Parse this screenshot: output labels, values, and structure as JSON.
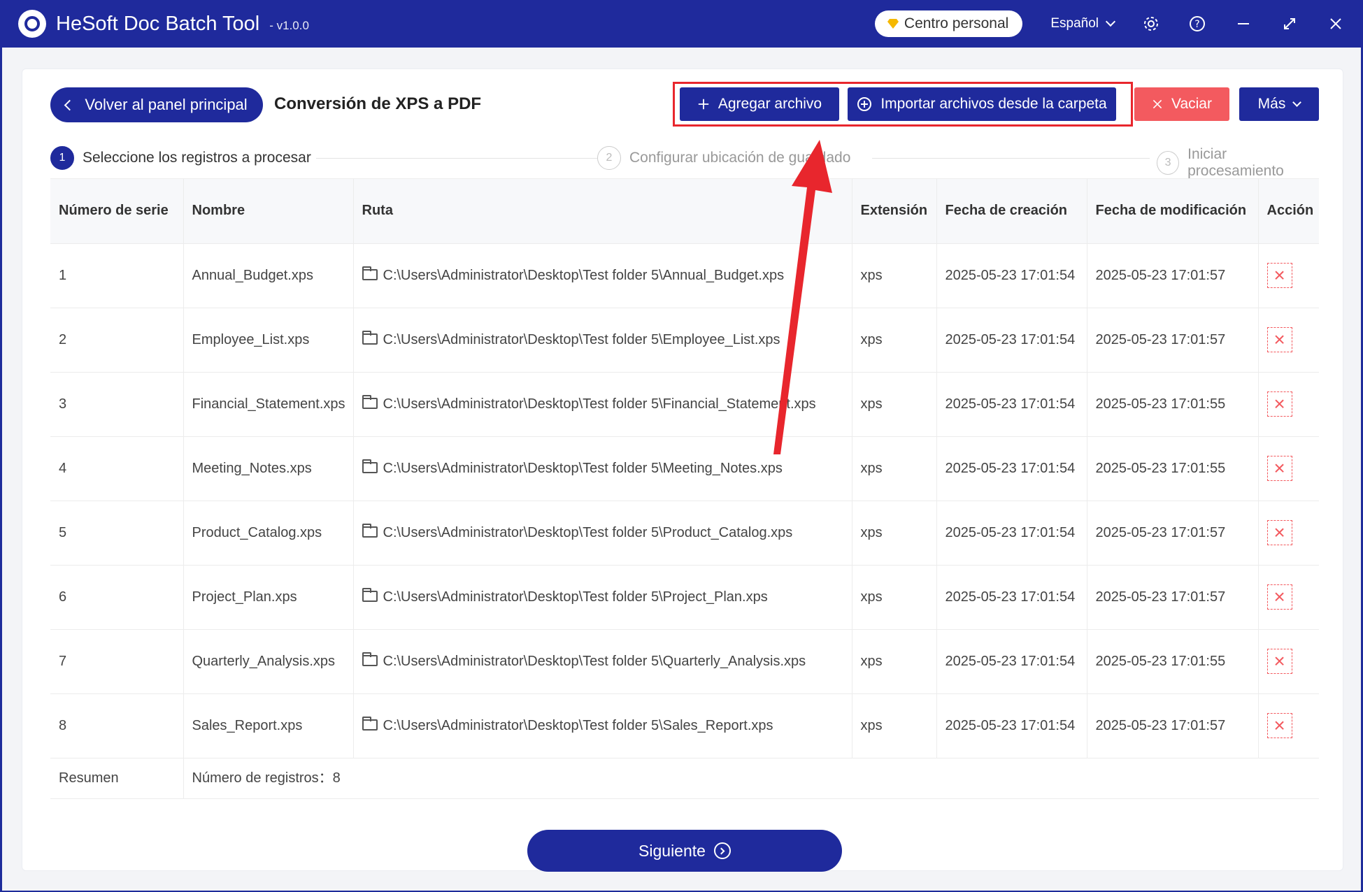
{
  "app": {
    "name": "HeSoft Doc Batch Tool",
    "version": "- v1.0.0",
    "personal_center": "Centro personal",
    "language": "Español"
  },
  "toolbar": {
    "back_label": "Volver al panel principal",
    "page_title": "Conversión de XPS a PDF",
    "add_file": "Agregar archivo",
    "import_folder": "Importar archivos desde la carpeta",
    "clear": "Vaciar",
    "more": "Más"
  },
  "steps": [
    {
      "num": "1",
      "label": "Seleccione los registros a procesar"
    },
    {
      "num": "2",
      "label": "Configurar ubicación de guardado"
    },
    {
      "num": "3",
      "label": "Iniciar procesamiento"
    }
  ],
  "table": {
    "headers": {
      "serial": "Número de serie",
      "name": "Nombre",
      "path": "Ruta",
      "ext": "Extensión",
      "created": "Fecha de creación",
      "modified": "Fecha de modificación",
      "action": "Acción"
    },
    "rows": [
      {
        "serial": "1",
        "name": "Annual_Budget.xps",
        "path": "C:\\Users\\Administrator\\Desktop\\Test folder 5\\Annual_Budget.xps",
        "ext": "xps",
        "created": "2025-05-23 17:01:54",
        "modified": "2025-05-23 17:01:57"
      },
      {
        "serial": "2",
        "name": "Employee_List.xps",
        "path": "C:\\Users\\Administrator\\Desktop\\Test folder 5\\Employee_List.xps",
        "ext": "xps",
        "created": "2025-05-23 17:01:54",
        "modified": "2025-05-23 17:01:57"
      },
      {
        "serial": "3",
        "name": "Financial_Statement.xps",
        "path": "C:\\Users\\Administrator\\Desktop\\Test folder 5\\Financial_Statement.xps",
        "ext": "xps",
        "created": "2025-05-23 17:01:54",
        "modified": "2025-05-23 17:01:55"
      },
      {
        "serial": "4",
        "name": "Meeting_Notes.xps",
        "path": "C:\\Users\\Administrator\\Desktop\\Test folder 5\\Meeting_Notes.xps",
        "ext": "xps",
        "created": "2025-05-23 17:01:54",
        "modified": "2025-05-23 17:01:55"
      },
      {
        "serial": "5",
        "name": "Product_Catalog.xps",
        "path": "C:\\Users\\Administrator\\Desktop\\Test folder 5\\Product_Catalog.xps",
        "ext": "xps",
        "created": "2025-05-23 17:01:54",
        "modified": "2025-05-23 17:01:57"
      },
      {
        "serial": "6",
        "name": "Project_Plan.xps",
        "path": "C:\\Users\\Administrator\\Desktop\\Test folder 5\\Project_Plan.xps",
        "ext": "xps",
        "created": "2025-05-23 17:01:54",
        "modified": "2025-05-23 17:01:57"
      },
      {
        "serial": "7",
        "name": "Quarterly_Analysis.xps",
        "path": "C:\\Users\\Administrator\\Desktop\\Test folder 5\\Quarterly_Analysis.xps",
        "ext": "xps",
        "created": "2025-05-23 17:01:54",
        "modified": "2025-05-23 17:01:55"
      },
      {
        "serial": "8",
        "name": "Sales_Report.xps",
        "path": "C:\\Users\\Administrator\\Desktop\\Test folder 5\\Sales_Report.xps",
        "ext": "xps",
        "created": "2025-05-23 17:01:54",
        "modified": "2025-05-23 17:01:57"
      }
    ],
    "summary_label": "Resumen",
    "summary_value": "Número de registros：8"
  },
  "next_label": "Siguiente",
  "colors": {
    "primary": "#1f2a9c",
    "danger": "#f35a5f",
    "annotation": "#e8262d"
  }
}
